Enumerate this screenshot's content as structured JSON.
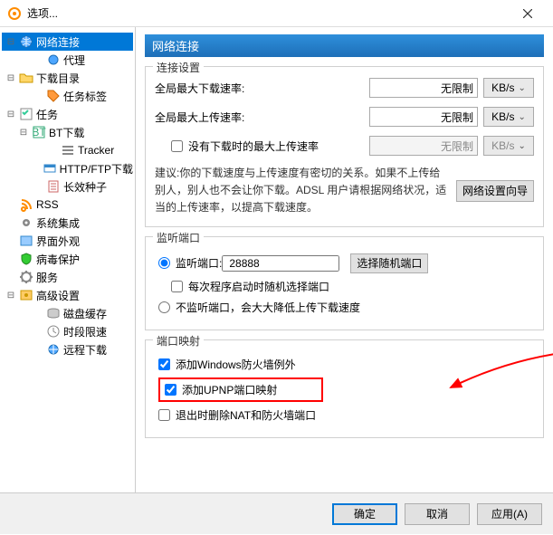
{
  "window": {
    "title": "选项..."
  },
  "sidebar": {
    "items": [
      {
        "label": "网络连接",
        "icon": "globe",
        "selected": true
      },
      {
        "label": "代理",
        "icon": "globe-small",
        "indent": 2
      },
      {
        "label": "下载目录",
        "icon": "folder-dl"
      },
      {
        "label": "任务标签",
        "icon": "tag",
        "indent": 2
      },
      {
        "label": "任务",
        "icon": "task"
      },
      {
        "label": "BT下载",
        "icon": "bt",
        "indent": 2
      },
      {
        "label": "Tracker",
        "icon": "list",
        "indent": 3
      },
      {
        "label": "HTTP/FTP下载",
        "icon": "http",
        "indent": 2
      },
      {
        "label": "长效种子",
        "icon": "seed",
        "indent": 2
      },
      {
        "label": "RSS",
        "icon": "rss"
      },
      {
        "label": "系统集成",
        "icon": "sys"
      },
      {
        "label": "界面外观",
        "icon": "ui"
      },
      {
        "label": "病毒保护",
        "icon": "shield"
      },
      {
        "label": "服务",
        "icon": "gear"
      },
      {
        "label": "高级设置",
        "icon": "adv"
      },
      {
        "label": "磁盘缓存",
        "icon": "disk",
        "indent": 2
      },
      {
        "label": "时段限速",
        "icon": "clock",
        "indent": 2
      },
      {
        "label": "远程下载",
        "icon": "remote",
        "indent": 2
      }
    ]
  },
  "panel": {
    "title": "网络连接",
    "group1": {
      "legend": "连接设置",
      "max_dl_label": "全局最大下载速率:",
      "max_dl_value": "无限制",
      "max_ul_label": "全局最大上传速率:",
      "max_ul_value": "无限制",
      "no_dl_label": "没有下载时的最大上传速率",
      "no_dl_value": "无限制",
      "unit": "KB/s",
      "hint": "建议:你的下载速度与上传速度有密切的关系。如果不上传给别人，别人也不会让你下载。ADSL 用户请根据网络状况，适当的上传速率，以提高下载速度。",
      "wizard_btn": "网络设置向导"
    },
    "group2": {
      "legend": "监听端口",
      "listen_label": "监听端口:",
      "port_value": "28888",
      "random_btn": "选择随机端口",
      "random_each_label": "每次程序启动时随机选择端口",
      "no_listen_label": "不监听端口，会大大降低上传下载速度"
    },
    "group3": {
      "legend": "端口映射",
      "fw_label": "添加Windows防火墙例外",
      "upnp_label": "添加UPNP端口映射",
      "nat_label": "退出时删除NAT和防火墙端口"
    }
  },
  "footer": {
    "ok": "确定",
    "cancel": "取消",
    "apply": "应用(A)"
  }
}
